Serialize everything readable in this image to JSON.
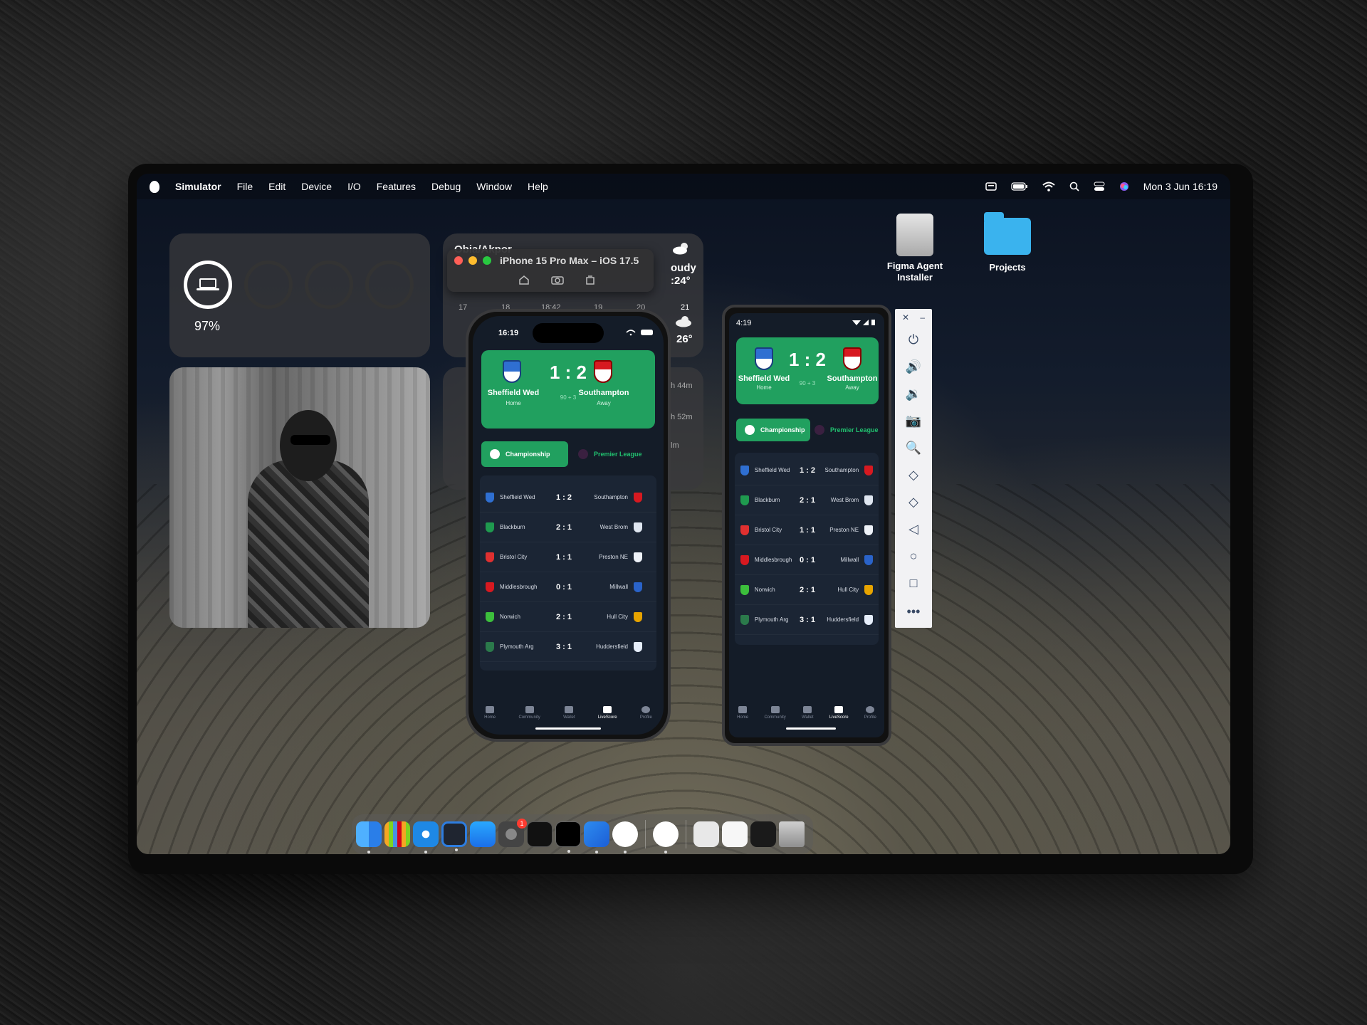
{
  "menubar": {
    "app_name": "Simulator",
    "items": [
      "File",
      "Edit",
      "Device",
      "I/O",
      "Features",
      "Debug",
      "Window",
      "Help"
    ],
    "clock": "Mon 3 Jun  16:19"
  },
  "widgets": {
    "battery_percent": "97%",
    "weather": {
      "location": "Obia/Akpor",
      "condition_partial": "oudy",
      "temp_partial": ":24°",
      "hours": [
        "17",
        "18",
        "18:42",
        "19",
        "20",
        "21"
      ],
      "temp_right": "26°",
      "side_times": [
        "h 44m",
        "h 52m",
        "lm"
      ]
    }
  },
  "simulator": {
    "title": "iPhone 15 Pro Max – iOS 17.5"
  },
  "desktop_icons": {
    "installer": "Figma Agent Installer",
    "projects": "Projects"
  },
  "iphone": {
    "time": "16:19",
    "match": {
      "home": "Sheffield Wed",
      "home_label": "Home",
      "score": "1 : 2",
      "minute": "90 + 3",
      "away": "Southampton",
      "away_label": "Away"
    },
    "tab_active": "Championship",
    "tab_inactive": "Premier League",
    "fixtures": [
      {
        "home": "Sheffield Wed",
        "score": "1 : 2",
        "away": "Southampton"
      },
      {
        "home": "Blackburn",
        "score": "2 : 1",
        "away": "West Brom"
      },
      {
        "home": "Bristol City",
        "score": "1 : 1",
        "away": "Preston NE"
      },
      {
        "home": "Middlesbrough",
        "score": "0 : 1",
        "away": "Millwall"
      },
      {
        "home": "Norwich",
        "score": "2 : 1",
        "away": "Hull City"
      },
      {
        "home": "Plymouth Arg",
        "score": "3 : 1",
        "away": "Huddersfield"
      }
    ],
    "nav": [
      "Home",
      "Community",
      "Wallet",
      "LiveScore",
      "Profile"
    ]
  },
  "android": {
    "time": "4:19"
  },
  "colors": {
    "accent_green": "#21a05f",
    "app_background": "#141c28"
  }
}
